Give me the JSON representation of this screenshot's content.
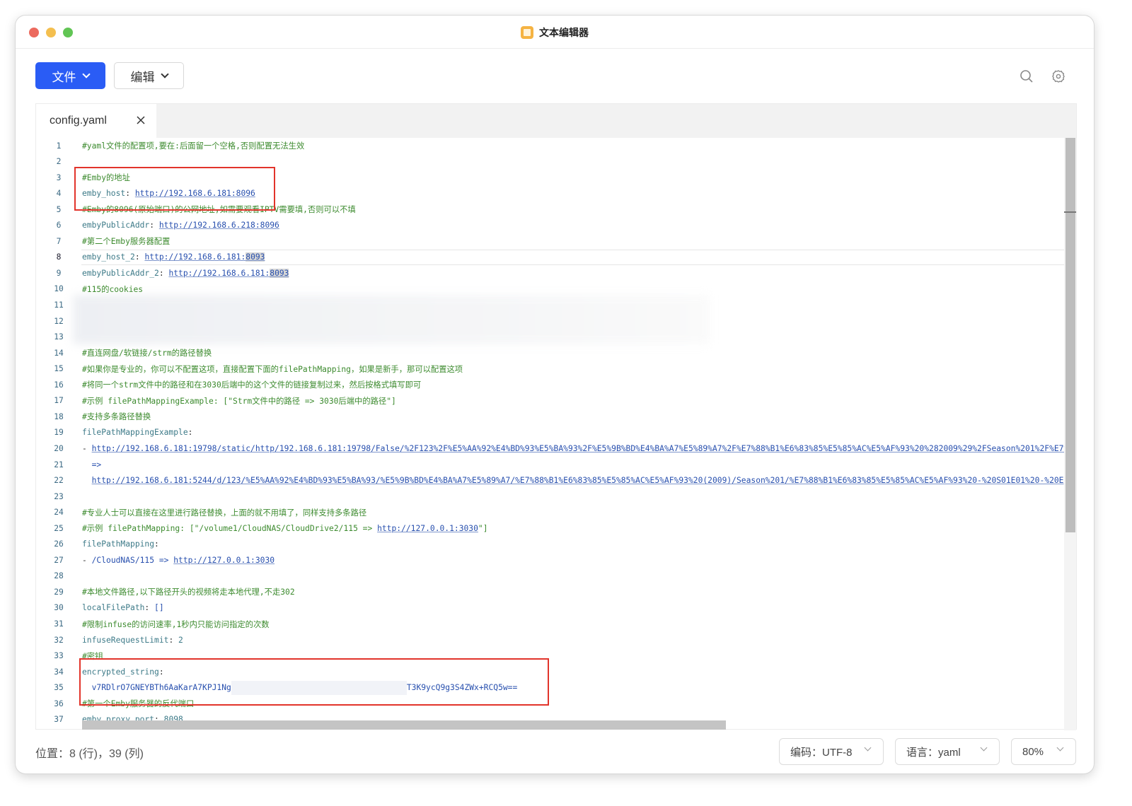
{
  "window": {
    "title": "文本编辑器"
  },
  "toolbar": {
    "file_label": "文件",
    "edit_label": "编辑"
  },
  "tab": {
    "name": "config.yaml"
  },
  "editor": {
    "lines": [
      {
        "n": "1",
        "s": [
          {
            "t": "#yaml文件的配置项,要在:后面留一个空格,否则配置无法生效",
            "c": "comment"
          }
        ]
      },
      {
        "n": "2",
        "s": []
      },
      {
        "n": "3",
        "s": [
          {
            "t": "#Emby的地址",
            "c": "comment"
          }
        ]
      },
      {
        "n": "4",
        "s": [
          {
            "t": "emby_host",
            "c": "key"
          },
          {
            "t": ": ",
            "c": "punct"
          },
          {
            "t": "http://192.168.6.181:8096",
            "c": "link"
          }
        ]
      },
      {
        "n": "5",
        "s": [
          {
            "t": "#Emby的8096(原始端口)的公网地址,如需要观看IPTV需要填,否则可以不填",
            "c": "comment"
          }
        ]
      },
      {
        "n": "6",
        "s": [
          {
            "t": "embyPublicAddr",
            "c": "key"
          },
          {
            "t": ": ",
            "c": "punct"
          },
          {
            "t": "http://192.168.6.218:8096",
            "c": "link"
          }
        ]
      },
      {
        "n": "7",
        "s": [
          {
            "t": "#第二个Emby服务器配置",
            "c": "comment"
          }
        ]
      },
      {
        "n": "8",
        "s": [
          {
            "t": "emby_host_2",
            "c": "key"
          },
          {
            "t": ": ",
            "c": "punct"
          },
          {
            "t": "http://192.168.6.181:",
            "c": "link"
          },
          {
            "t": "8093",
            "c": "link sel"
          }
        ]
      },
      {
        "n": "9",
        "s": [
          {
            "t": "embyPublicAddr_2",
            "c": "key"
          },
          {
            "t": ": ",
            "c": "punct"
          },
          {
            "t": "http://192.168.6.181:",
            "c": "link"
          },
          {
            "t": "8093",
            "c": "link sel"
          }
        ]
      },
      {
        "n": "10",
        "s": [
          {
            "t": "#115的cookies",
            "c": "comment"
          }
        ]
      },
      {
        "n": "11",
        "s": []
      },
      {
        "n": "12",
        "s": []
      },
      {
        "n": "13",
        "s": []
      },
      {
        "n": "14",
        "s": [
          {
            "t": "#直连网盘/软链接/strm的路径替换",
            "c": "comment"
          }
        ]
      },
      {
        "n": "15",
        "s": [
          {
            "t": "#如果你是专业的，你可以不配置这项，直接配置下面的filePathMapping，如果是新手，那可以配置这项",
            "c": "comment"
          }
        ]
      },
      {
        "n": "16",
        "s": [
          {
            "t": "#将同一个strm文件中的路径和在3030后端中的这个文件的链接复制过来，然后按格式填写即可",
            "c": "comment"
          }
        ]
      },
      {
        "n": "17",
        "s": [
          {
            "t": "#示例 filePathMappingExample: [\"Strm文件中的路径 => 3030后端中的路径\"]",
            "c": "comment"
          }
        ]
      },
      {
        "n": "18",
        "s": [
          {
            "t": "#支持多条路径替换",
            "c": "comment"
          }
        ]
      },
      {
        "n": "19",
        "s": [
          {
            "t": "filePathMappingExample",
            "c": "key"
          },
          {
            "t": ":",
            "c": "punct"
          }
        ]
      },
      {
        "n": "20",
        "s": [
          {
            "t": "- ",
            "c": "punct"
          },
          {
            "t": "http://192.168.6.181:19798/static/http/192.168.6.181:19798/False/%2F123%2F%E5%AA%92%E4%BD%93%E5%BA%93%2F%E5%9B%BD%E4%BA%A7%E5%89%A7%2F%E7%88%B1%E6%83%85%E5%85%AC%E5%AF%93%20%282009%29%2FSeason%201%2F%E7%",
            "c": "link"
          }
        ]
      },
      {
        "n": "21",
        "s": [
          {
            "t": "  =>",
            "c": "plain"
          }
        ]
      },
      {
        "n": "22",
        "s": [
          {
            "t": "  ",
            "c": "punct"
          },
          {
            "t": "http://192.168.6.181:5244/d/123/%E5%AA%92%E4%BD%93%E5%BA%93/%E5%9B%BD%E4%BA%A7%E5%89%A7/%E7%88%B1%E6%83%85%E5%85%AC%E5%AF%93%20(2009)/Season%201/%E7%88%B1%E6%83%85%E5%85%AC%E5%AF%93%20-%20S01E01%20-%20E",
            "c": "link"
          }
        ]
      },
      {
        "n": "23",
        "s": []
      },
      {
        "n": "24",
        "s": [
          {
            "t": "#专业人士可以直接在这里进行路径替换，上面的就不用填了，同样支持多条路径",
            "c": "comment"
          }
        ]
      },
      {
        "n": "25",
        "s": [
          {
            "t": "#示例 filePathMapping: [\"/volume1/CloudNAS/CloudDrive2/115 => ",
            "c": "comment"
          },
          {
            "t": "http://127.0.0.1:3030",
            "c": "comment link"
          },
          {
            "t": "\"]",
            "c": "comment"
          }
        ]
      },
      {
        "n": "26",
        "s": [
          {
            "t": "filePathMapping",
            "c": "key"
          },
          {
            "t": ":",
            "c": "punct"
          }
        ]
      },
      {
        "n": "27",
        "s": [
          {
            "t": "- ",
            "c": "punct"
          },
          {
            "t": "/CloudNAS/115 => ",
            "c": "plain"
          },
          {
            "t": "http://127.0.0.1:3030",
            "c": "link"
          }
        ]
      },
      {
        "n": "28",
        "s": []
      },
      {
        "n": "29",
        "s": [
          {
            "t": "#本地文件路径,以下路径开头的视频将走本地代理,不走302",
            "c": "comment"
          }
        ]
      },
      {
        "n": "30",
        "s": [
          {
            "t": "localFilePath",
            "c": "key"
          },
          {
            "t": ": ",
            "c": "punct"
          },
          {
            "t": "[]",
            "c": "plain"
          }
        ]
      },
      {
        "n": "31",
        "s": [
          {
            "t": "#限制infuse的访问速率,1秒内只能访问指定的次数",
            "c": "comment"
          }
        ]
      },
      {
        "n": "32",
        "s": [
          {
            "t": "infuseRequestLimit",
            "c": "key"
          },
          {
            "t": ": ",
            "c": "punct"
          },
          {
            "t": "2",
            "c": "key"
          }
        ]
      },
      {
        "n": "33",
        "s": [
          {
            "t": "#密钥",
            "c": "comment"
          }
        ]
      },
      {
        "n": "34",
        "s": [
          {
            "t": "encrypted_string",
            "c": "key"
          },
          {
            "t": ":",
            "c": "punct"
          }
        ]
      },
      {
        "n": "35",
        "s": [
          {
            "t": "  v7RDlrO7GNEYBTh6AaKarA7KPJ1Ng",
            "c": "plain"
          },
          {
            "t": "",
            "c": "blank"
          },
          {
            "t": "T3K9ycQ9g3S4ZWx+RCQ5w==",
            "c": "plain"
          }
        ]
      },
      {
        "n": "36",
        "s": [
          {
            "t": "#第一个Emby服务器的反代端口",
            "c": "comment"
          }
        ]
      },
      {
        "n": "37",
        "s": [
          {
            "t": "emby_proxy_port",
            "c": "key"
          },
          {
            "t": ": ",
            "c": "punct"
          },
          {
            "t": "8098",
            "c": "key"
          }
        ]
      }
    ],
    "current_line": "8"
  },
  "status": {
    "position": "位置：8 (行)，39 (列)",
    "encoding": "编码：UTF-8",
    "language": "语言：yaml",
    "zoom": "80%"
  },
  "colors": {
    "accent": "#2a5cf5",
    "comment": "#3d8b2f",
    "link": "#274fae",
    "highlight_box": "#e2342b"
  }
}
